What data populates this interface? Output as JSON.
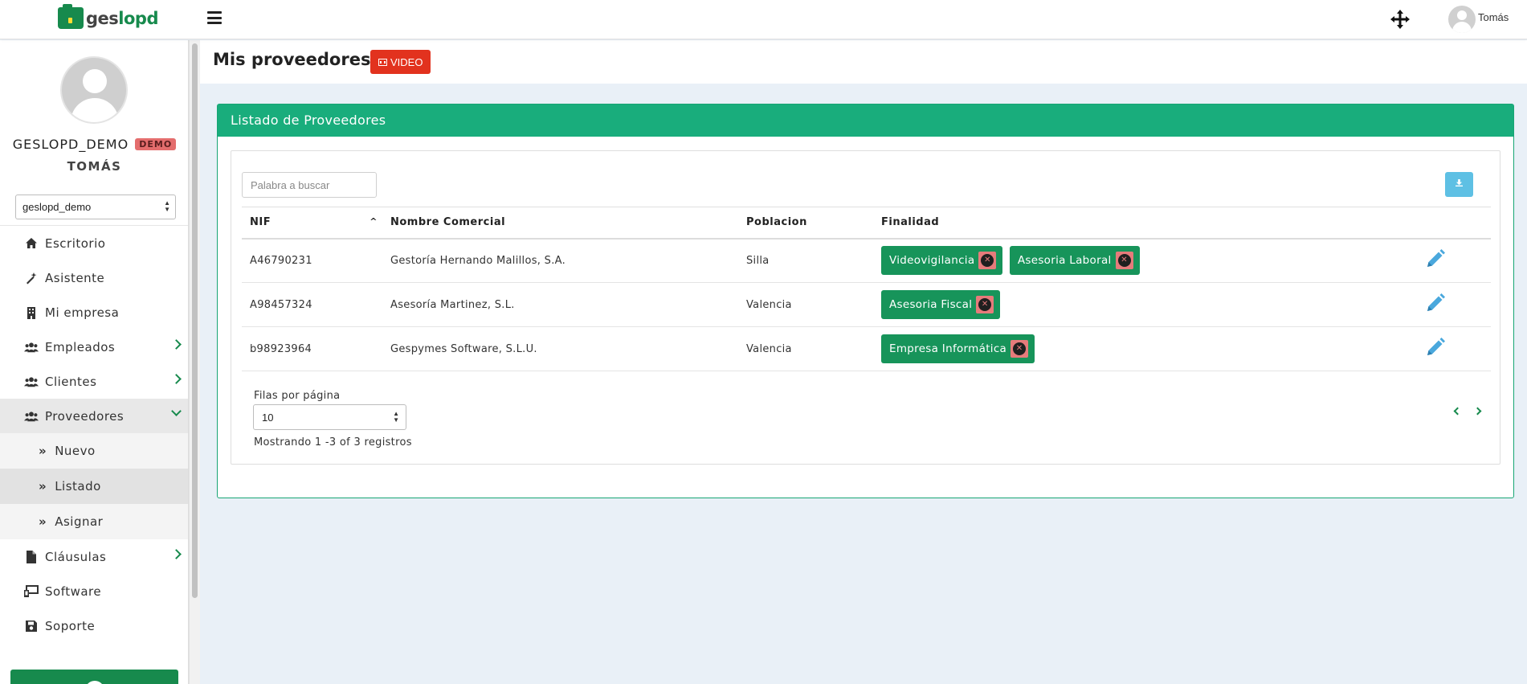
{
  "brand": {
    "name_part1": "ges",
    "name_part2": "lopd"
  },
  "topbar": {
    "user_name": "Tomás"
  },
  "sidebar": {
    "org_name": "GESLOPD_DEMO",
    "org_badge": "DEMO",
    "user_name": "TOMÁS",
    "company_select": "geslopd_demo",
    "items": [
      {
        "label": "Escritorio",
        "icon": "home-icon"
      },
      {
        "label": "Asistente",
        "icon": "magic-wand-icon"
      },
      {
        "label": "Mi empresa",
        "icon": "building-icon"
      },
      {
        "label": "Empleados",
        "icon": "users-icon"
      },
      {
        "label": "Clientes",
        "icon": "users-icon"
      },
      {
        "label": "Proveedores",
        "icon": "users-icon"
      },
      {
        "label": "Cláusulas",
        "icon": "file-icon"
      },
      {
        "label": "Software",
        "icon": "laptop-icon"
      },
      {
        "label": "Soporte",
        "icon": "save-icon"
      }
    ],
    "sub_items": [
      {
        "label": "Nuevo"
      },
      {
        "label": "Listado"
      },
      {
        "label": "Asignar"
      }
    ]
  },
  "header": {
    "title": "Mis proveedores |",
    "video_label": "VIDEO"
  },
  "panel": {
    "title": "Listado de Proveedores",
    "search_placeholder": "Palabra a buscar",
    "columns": [
      "NIF",
      "Nombre Comercial",
      "Poblacion",
      "Finalidad"
    ],
    "rows": [
      {
        "nif": "A46790231",
        "nombre": "Gestoría Hernando Malillos, S.A.",
        "poblacion": "Silla",
        "finalidad": [
          "Videovigilancia",
          "Asesoria Laboral"
        ]
      },
      {
        "nif": "A98457324",
        "nombre": "Asesoría Martinez, S.L.",
        "poblacion": "Valencia",
        "finalidad": [
          "Asesoria Fiscal"
        ]
      },
      {
        "nif": "b98923964",
        "nombre": "Gespymes Software, S.L.U.",
        "poblacion": "Valencia",
        "finalidad": [
          "Empresa Informática"
        ]
      }
    ],
    "rows_per_page_label": "Filas por página",
    "rows_per_page_value": "10",
    "showing_text": "Mostrando 1 -3 of 3 registros"
  },
  "colors": {
    "brand_green": "#178a4d",
    "panel_header": "#19ad7c",
    "tag_green": "#17945a",
    "video_red": "#e2321e",
    "download_blue": "#5ec0e4",
    "pencil_blue": "#4aa8dd"
  }
}
